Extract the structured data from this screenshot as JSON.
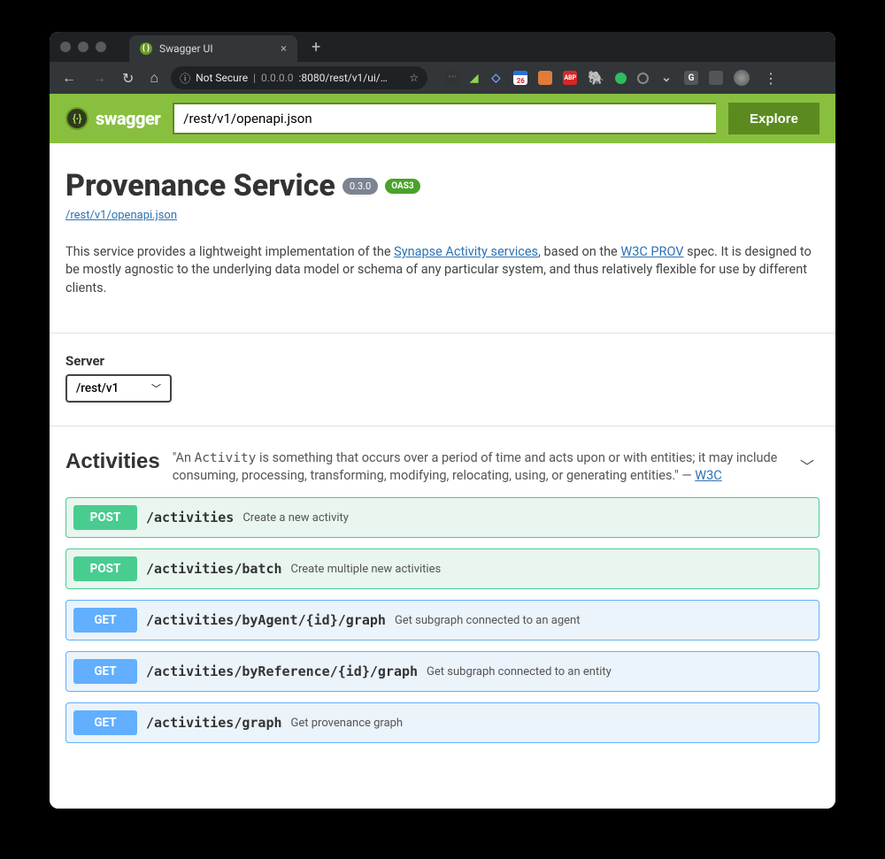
{
  "browser": {
    "tab_title": "Swagger UI",
    "omnibox": {
      "secure_label": "Not Secure",
      "host": "0.0.0.0",
      "port_path": ":8080/rest/v1/ui/…"
    }
  },
  "swagger": {
    "brand": "swagger",
    "spec_input": "/rest/v1/openapi.json",
    "explore_label": "Explore"
  },
  "api": {
    "title": "Provenance Service",
    "version": "0.3.0",
    "oas_badge": "OAS3",
    "spec_link": "/rest/v1/openapi.json",
    "description_pre": "This service provides a lightweight implementation of the ",
    "link1": "Synapse Activity services",
    "description_mid": ", based on the ",
    "link2": "W3C PROV",
    "description_post": " spec. It is designed to be mostly agnostic to the underlying data model or schema of any particular system, and thus relatively flexible for use by different clients."
  },
  "server": {
    "label": "Server",
    "selected": "/rest/v1"
  },
  "tag": {
    "name": "Activities",
    "desc_pre": "\"An ",
    "desc_code": "Activity",
    "desc_mid": " is something that occurs over a period of time and acts upon or with entities; it may include consuming, processing, transforming, modifying, relocating, using, or generating entities.\" — ",
    "desc_link": "W3C"
  },
  "operations": [
    {
      "method": "POST",
      "class": "post",
      "path": "/activities",
      "summary": "Create a new activity"
    },
    {
      "method": "POST",
      "class": "post",
      "path": "/activities/batch",
      "summary": "Create multiple new activities"
    },
    {
      "method": "GET",
      "class": "get",
      "path": "/activities/byAgent/{id}/graph",
      "summary": "Get subgraph connected to an agent"
    },
    {
      "method": "GET",
      "class": "get",
      "path": "/activities/byReference/{id}/graph",
      "summary": "Get subgraph connected to an entity"
    },
    {
      "method": "GET",
      "class": "get",
      "path": "/activities/graph",
      "summary": "Get provenance graph"
    }
  ],
  "ext_cal": "26"
}
